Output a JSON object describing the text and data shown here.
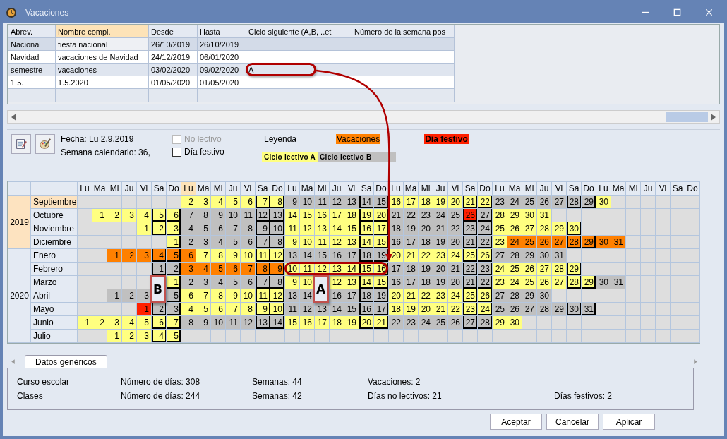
{
  "window": {
    "title": "Vacaciones"
  },
  "holidays": {
    "columns": [
      {
        "label": "Abrev.",
        "selected": false
      },
      {
        "label": "Nombre compl.",
        "selected": true
      },
      {
        "label": "Desde",
        "selected": false
      },
      {
        "label": "Hasta",
        "selected": false
      },
      {
        "label": "Ciclo siguiente (A,B, ..et",
        "selected": false
      },
      {
        "label": "Número de la semana pos",
        "selected": false
      }
    ],
    "rows": [
      {
        "selected": true,
        "cells": [
          "Nacional",
          "fiesta nacional",
          "26/10/2019",
          "26/10/2019"
        ]
      },
      {
        "selected": false,
        "cells": [
          "Navidad",
          "vacaciones de Navidad",
          "24/12/2019",
          "06/01/2020"
        ]
      },
      {
        "selected": false,
        "cells": [
          "semestre",
          "vacaciones",
          "03/02/2020",
          "09/02/2020",
          "A"
        ]
      },
      {
        "selected": false,
        "cells": [
          "1.5.",
          "1.5.2020",
          "01/05/2020",
          "01/05/2020"
        ]
      }
    ]
  },
  "date_info": {
    "fecha": "Fecha: Lu 2.9.2019",
    "semana": "Semana calendario: 36,"
  },
  "checkboxes": [
    {
      "label": "No lectivo",
      "checked": false,
      "disabled": true
    },
    {
      "label": "Día festivo",
      "checked": false,
      "disabled": false
    }
  ],
  "legend": {
    "title": "Leyenda",
    "items": [
      {
        "label": "Vacaciones",
        "kind": "vacation"
      },
      {
        "label": "Día festivo",
        "kind": "holiday"
      },
      {
        "label": "Ciclo lectivo A",
        "kind": "a"
      },
      {
        "label": "Ciclo lectivo B",
        "kind": "b"
      }
    ]
  },
  "calendar": {
    "day_headers": [
      {
        "label": "Lu",
        "selected": false
      },
      {
        "label": "Ma",
        "selected": false
      },
      {
        "label": "Mi",
        "selected": false
      },
      {
        "label": "Ju",
        "selected": false
      },
      {
        "label": "Vi",
        "selected": false
      },
      {
        "label": "Sa",
        "selected": false
      },
      {
        "label": "Do",
        "selected": false
      },
      {
        "label": "Lu",
        "selected": true
      },
      {
        "label": "Ma",
        "selected": false
      },
      {
        "label": "Mi",
        "selected": false
      },
      {
        "label": "Ju",
        "selected": false
      },
      {
        "label": "Vi",
        "selected": false
      },
      {
        "label": "Sa",
        "selected": false
      },
      {
        "label": "Do",
        "selected": false
      },
      {
        "label": "Lu",
        "selected": false
      },
      {
        "label": "Ma",
        "selected": false
      },
      {
        "label": "Mi",
        "selected": false
      },
      {
        "label": "Ju",
        "selected": false
      },
      {
        "label": "Vi",
        "selected": false
      },
      {
        "label": "Sa",
        "selected": false
      },
      {
        "label": "Do",
        "selected": false
      },
      {
        "label": "Lu",
        "selected": false
      },
      {
        "label": "Ma",
        "selected": false
      },
      {
        "label": "Mi",
        "selected": false
      },
      {
        "label": "Ju",
        "selected": false
      },
      {
        "label": "Vi",
        "selected": false
      },
      {
        "label": "Sa",
        "selected": false
      },
      {
        "label": "Do",
        "selected": false
      },
      {
        "label": "Lu",
        "selected": false
      },
      {
        "label": "Ma",
        "selected": false
      },
      {
        "label": "Mi",
        "selected": false
      },
      {
        "label": "Ju",
        "selected": false
      },
      {
        "label": "Vi",
        "selected": false
      },
      {
        "label": "Sa",
        "selected": false
      },
      {
        "label": "Do",
        "selected": false
      },
      {
        "label": "Lu",
        "selected": false
      },
      {
        "label": "Ma",
        "selected": false
      },
      {
        "label": "Mi",
        "selected": false
      },
      {
        "label": "Ju",
        "selected": false
      },
      {
        "label": "Vi",
        "selected": false
      },
      {
        "label": "Sa",
        "selected": false
      },
      {
        "label": "Do",
        "selected": false
      }
    ],
    "years": [
      {
        "label": "2019",
        "selected": true,
        "months": [
          {
            "name": "Septiembre",
            "selected": true,
            "cells": [
              {
                "kind": "blank"
              },
              {
                "kind": "blank"
              },
              {
                "kind": "blank"
              },
              {
                "kind": "blank"
              },
              {
                "kind": "blank"
              },
              {
                "kind": "blank"
              },
              {
                "kind": "blank"
              },
              {
                "day": "2",
                "kind": "a"
              },
              {
                "day": "3",
                "kind": "a"
              },
              {
                "day": "4",
                "kind": "a"
              },
              {
                "day": "5",
                "kind": "a"
              },
              {
                "day": "6",
                "kind": "a"
              },
              {
                "day": "7",
                "kind": "a"
              },
              {
                "day": "8",
                "kind": "a"
              },
              {
                "day": "9",
                "kind": "b"
              },
              {
                "day": "10",
                "kind": "b"
              },
              {
                "day": "11",
                "kind": "b"
              },
              {
                "day": "12",
                "kind": "b"
              },
              {
                "day": "13",
                "kind": "b"
              },
              {
                "day": "14",
                "kind": "b"
              },
              {
                "day": "15",
                "kind": "b"
              },
              {
                "day": "16",
                "kind": "a"
              },
              {
                "day": "17",
                "kind": "a"
              },
              {
                "day": "18",
                "kind": "a"
              },
              {
                "day": "19",
                "kind": "a"
              },
              {
                "day": "20",
                "kind": "a"
              },
              {
                "day": "21",
                "kind": "a"
              },
              {
                "day": "22",
                "kind": "a"
              },
              {
                "day": "23",
                "kind": "b"
              },
              {
                "day": "24",
                "kind": "b"
              },
              {
                "day": "25",
                "kind": "b"
              },
              {
                "day": "26",
                "kind": "b"
              },
              {
                "day": "27",
                "kind": "b"
              },
              {
                "day": "28",
                "kind": "b"
              },
              {
                "day": "29",
                "kind": "b"
              },
              {
                "day": "30",
                "kind": "a"
              }
            ]
          },
          {
            "name": "Octubre",
            "selected": false,
            "cells": [
              {
                "kind": "blank"
              },
              {
                "day": "1",
                "kind": "a"
              },
              {
                "day": "2",
                "kind": "a"
              },
              {
                "day": "3",
                "kind": "a"
              },
              {
                "day": "4",
                "kind": "a"
              },
              {
                "day": "5",
                "kind": "a"
              },
              {
                "day": "6",
                "kind": "a"
              },
              {
                "day": "7",
                "kind": "b"
              },
              {
                "day": "8",
                "kind": "b"
              },
              {
                "day": "9",
                "kind": "b"
              },
              {
                "day": "10",
                "kind": "b"
              },
              {
                "day": "11",
                "kind": "b"
              },
              {
                "day": "12",
                "kind": "b"
              },
              {
                "day": "13",
                "kind": "b"
              },
              {
                "day": "14",
                "kind": "a"
              },
              {
                "day": "15",
                "kind": "a"
              },
              {
                "day": "16",
                "kind": "a"
              },
              {
                "day": "17",
                "kind": "a"
              },
              {
                "day": "18",
                "kind": "a"
              },
              {
                "day": "19",
                "kind": "a"
              },
              {
                "day": "20",
                "kind": "a"
              },
              {
                "day": "21",
                "kind": "b"
              },
              {
                "day": "22",
                "kind": "b"
              },
              {
                "day": "23",
                "kind": "b"
              },
              {
                "day": "24",
                "kind": "b"
              },
              {
                "day": "25",
                "kind": "b"
              },
              {
                "day": "26",
                "kind": "holiday"
              },
              {
                "day": "27",
                "kind": "b"
              },
              {
                "day": "28",
                "kind": "a"
              },
              {
                "day": "29",
                "kind": "a"
              },
              {
                "day": "30",
                "kind": "a"
              },
              {
                "day": "31",
                "kind": "a"
              }
            ]
          },
          {
            "name": "Noviembre",
            "selected": false,
            "cells": [
              {
                "kind": "blank"
              },
              {
                "kind": "blank"
              },
              {
                "kind": "blank"
              },
              {
                "kind": "blank"
              },
              {
                "day": "1",
                "kind": "a"
              },
              {
                "day": "2",
                "kind": "a"
              },
              {
                "day": "3",
                "kind": "a"
              },
              {
                "day": "4",
                "kind": "b"
              },
              {
                "day": "5",
                "kind": "b"
              },
              {
                "day": "6",
                "kind": "b"
              },
              {
                "day": "7",
                "kind": "b"
              },
              {
                "day": "8",
                "kind": "b"
              },
              {
                "day": "9",
                "kind": "b"
              },
              {
                "day": "10",
                "kind": "b"
              },
              {
                "day": "11",
                "kind": "a"
              },
              {
                "day": "12",
                "kind": "a"
              },
              {
                "day": "13",
                "kind": "a"
              },
              {
                "day": "14",
                "kind": "a"
              },
              {
                "day": "15",
                "kind": "a"
              },
              {
                "day": "16",
                "kind": "a"
              },
              {
                "day": "17",
                "kind": "a"
              },
              {
                "day": "18",
                "kind": "b"
              },
              {
                "day": "19",
                "kind": "b"
              },
              {
                "day": "20",
                "kind": "b"
              },
              {
                "day": "21",
                "kind": "b"
              },
              {
                "day": "22",
                "kind": "b"
              },
              {
                "day": "23",
                "kind": "b"
              },
              {
                "day": "24",
                "kind": "b"
              },
              {
                "day": "25",
                "kind": "a"
              },
              {
                "day": "26",
                "kind": "a"
              },
              {
                "day": "27",
                "kind": "a"
              },
              {
                "day": "28",
                "kind": "a"
              },
              {
                "day": "29",
                "kind": "a"
              },
              {
                "day": "30",
                "kind": "a"
              }
            ]
          },
          {
            "name": "Diciembre",
            "selected": false,
            "cells": [
              {
                "kind": "blank"
              },
              {
                "kind": "blank"
              },
              {
                "kind": "blank"
              },
              {
                "kind": "blank"
              },
              {
                "kind": "blank"
              },
              {
                "kind": "blank"
              },
              {
                "day": "1",
                "kind": "a"
              },
              {
                "day": "2",
                "kind": "b"
              },
              {
                "day": "3",
                "kind": "b"
              },
              {
                "day": "4",
                "kind": "b"
              },
              {
                "day": "5",
                "kind": "b"
              },
              {
                "day": "6",
                "kind": "b"
              },
              {
                "day": "7",
                "kind": "b"
              },
              {
                "day": "8",
                "kind": "b"
              },
              {
                "day": "9",
                "kind": "a"
              },
              {
                "day": "10",
                "kind": "a"
              },
              {
                "day": "11",
                "kind": "a"
              },
              {
                "day": "12",
                "kind": "a"
              },
              {
                "day": "13",
                "kind": "a"
              },
              {
                "day": "14",
                "kind": "a"
              },
              {
                "day": "15",
                "kind": "a"
              },
              {
                "day": "16",
                "kind": "b"
              },
              {
                "day": "17",
                "kind": "b"
              },
              {
                "day": "18",
                "kind": "b"
              },
              {
                "day": "19",
                "kind": "b"
              },
              {
                "day": "20",
                "kind": "b"
              },
              {
                "day": "21",
                "kind": "b"
              },
              {
                "day": "22",
                "kind": "b"
              },
              {
                "day": "23",
                "kind": "a"
              },
              {
                "day": "24",
                "kind": "vacation"
              },
              {
                "day": "25",
                "kind": "vacation"
              },
              {
                "day": "26",
                "kind": "vacation"
              },
              {
                "day": "27",
                "kind": "vacation"
              },
              {
                "day": "28",
                "kind": "vacation"
              },
              {
                "day": "29",
                "kind": "vacation"
              },
              {
                "day": "30",
                "kind": "vacation"
              },
              {
                "day": "31",
                "kind": "vacation"
              }
            ]
          }
        ]
      },
      {
        "label": "2020",
        "selected": false,
        "months": [
          {
            "name": "Enero",
            "selected": false,
            "cells": [
              {
                "kind": "blank"
              },
              {
                "kind": "blank"
              },
              {
                "day": "1",
                "kind": "vacation"
              },
              {
                "day": "2",
                "kind": "vacation"
              },
              {
                "day": "3",
                "kind": "vacation"
              },
              {
                "day": "4",
                "kind": "vacation"
              },
              {
                "day": "5",
                "kind": "vacation"
              },
              {
                "day": "6",
                "kind": "vacation"
              },
              {
                "day": "7",
                "kind": "a"
              },
              {
                "day": "8",
                "kind": "a"
              },
              {
                "day": "9",
                "kind": "a"
              },
              {
                "day": "10",
                "kind": "a"
              },
              {
                "day": "11",
                "kind": "a"
              },
              {
                "day": "12",
                "kind": "a"
              },
              {
                "day": "13",
                "kind": "b"
              },
              {
                "day": "14",
                "kind": "b"
              },
              {
                "day": "15",
                "kind": "b"
              },
              {
                "day": "16",
                "kind": "b"
              },
              {
                "day": "17",
                "kind": "b"
              },
              {
                "day": "18",
                "kind": "b"
              },
              {
                "day": "19",
                "kind": "b"
              },
              {
                "day": "20",
                "kind": "a"
              },
              {
                "day": "21",
                "kind": "a"
              },
              {
                "day": "22",
                "kind": "a"
              },
              {
                "day": "23",
                "kind": "a"
              },
              {
                "day": "24",
                "kind": "a"
              },
              {
                "day": "25",
                "kind": "a"
              },
              {
                "day": "26",
                "kind": "a"
              },
              {
                "day": "27",
                "kind": "b"
              },
              {
                "day": "28",
                "kind": "b"
              },
              {
                "day": "29",
                "kind": "b"
              },
              {
                "day": "30",
                "kind": "b"
              },
              {
                "day": "31",
                "kind": "b"
              }
            ]
          },
          {
            "name": "Febrero",
            "selected": false,
            "cells": [
              {
                "kind": "blank"
              },
              {
                "kind": "blank"
              },
              {
                "kind": "blank"
              },
              {
                "kind": "blank"
              },
              {
                "kind": "blank"
              },
              {
                "day": "1",
                "kind": "b"
              },
              {
                "day": "2",
                "kind": "b"
              },
              {
                "day": "3",
                "kind": "vacation"
              },
              {
                "day": "4",
                "kind": "vacation"
              },
              {
                "day": "5",
                "kind": "vacation"
              },
              {
                "day": "6",
                "kind": "vacation"
              },
              {
                "day": "7",
                "kind": "vacation"
              },
              {
                "day": "8",
                "kind": "vacation"
              },
              {
                "day": "9",
                "kind": "vacation"
              },
              {
                "day": "10",
                "kind": "a"
              },
              {
                "day": "11",
                "kind": "a"
              },
              {
                "day": "12",
                "kind": "a"
              },
              {
                "day": "13",
                "kind": "a"
              },
              {
                "day": "14",
                "kind": "a"
              },
              {
                "day": "15",
                "kind": "a"
              },
              {
                "day": "16",
                "kind": "a"
              },
              {
                "day": "17",
                "kind": "b"
              },
              {
                "day": "18",
                "kind": "b"
              },
              {
                "day": "19",
                "kind": "b"
              },
              {
                "day": "20",
                "kind": "b"
              },
              {
                "day": "21",
                "kind": "b"
              },
              {
                "day": "22",
                "kind": "b"
              },
              {
                "day": "23",
                "kind": "b"
              },
              {
                "day": "24",
                "kind": "a"
              },
              {
                "day": "25",
                "kind": "a"
              },
              {
                "day": "26",
                "kind": "a"
              },
              {
                "day": "27",
                "kind": "a"
              },
              {
                "day": "28",
                "kind": "a"
              },
              {
                "day": "29",
                "kind": "a"
              }
            ]
          },
          {
            "name": "Marzo",
            "selected": false,
            "cells": [
              {
                "kind": "blank"
              },
              {
                "kind": "blank"
              },
              {
                "kind": "blank"
              },
              {
                "kind": "blank"
              },
              {
                "kind": "blank"
              },
              {
                "kind": "hidden"
              },
              {
                "day": "1",
                "kind": "a"
              },
              {
                "day": "2",
                "kind": "b"
              },
              {
                "day": "3",
                "kind": "b"
              },
              {
                "day": "4",
                "kind": "b"
              },
              {
                "day": "5",
                "kind": "b"
              },
              {
                "day": "6",
                "kind": "b"
              },
              {
                "day": "7",
                "kind": "b"
              },
              {
                "day": "8",
                "kind": "b"
              },
              {
                "day": "9",
                "kind": "a"
              },
              {
                "day": "10",
                "kind": "a"
              },
              {
                "kind": "hidden"
              },
              {
                "day": "12",
                "kind": "a"
              },
              {
                "day": "13",
                "kind": "a"
              },
              {
                "day": "14",
                "kind": "a"
              },
              {
                "day": "15",
                "kind": "a"
              },
              {
                "day": "16",
                "kind": "b"
              },
              {
                "day": "17",
                "kind": "b"
              },
              {
                "day": "18",
                "kind": "b"
              },
              {
                "day": "19",
                "kind": "b"
              },
              {
                "day": "20",
                "kind": "b"
              },
              {
                "day": "21",
                "kind": "b"
              },
              {
                "day": "22",
                "kind": "b"
              },
              {
                "day": "23",
                "kind": "a"
              },
              {
                "day": "24",
                "kind": "a"
              },
              {
                "day": "25",
                "kind": "a"
              },
              {
                "day": "26",
                "kind": "a"
              },
              {
                "day": "27",
                "kind": "a"
              },
              {
                "day": "28",
                "kind": "a"
              },
              {
                "day": "29",
                "kind": "a"
              },
              {
                "day": "30",
                "kind": "b"
              },
              {
                "day": "31",
                "kind": "b"
              }
            ]
          },
          {
            "name": "Abril",
            "selected": false,
            "cells": [
              {
                "kind": "blank"
              },
              {
                "kind": "blank"
              },
              {
                "day": "1",
                "kind": "b"
              },
              {
                "day": "2",
                "kind": "b"
              },
              {
                "day": "3",
                "kind": "b"
              },
              {
                "kind": "hidden"
              },
              {
                "day": "5",
                "kind": "b"
              },
              {
                "day": "6",
                "kind": "a"
              },
              {
                "day": "7",
                "kind": "a"
              },
              {
                "day": "8",
                "kind": "a"
              },
              {
                "day": "9",
                "kind": "a"
              },
              {
                "day": "10",
                "kind": "a"
              },
              {
                "day": "11",
                "kind": "a"
              },
              {
                "day": "12",
                "kind": "a"
              },
              {
                "day": "13",
                "kind": "b"
              },
              {
                "day": "14",
                "kind": "b"
              },
              {
                "kind": "hidden"
              },
              {
                "day": "16",
                "kind": "b"
              },
              {
                "day": "17",
                "kind": "b"
              },
              {
                "day": "18",
                "kind": "b"
              },
              {
                "day": "19",
                "kind": "b"
              },
              {
                "day": "20",
                "kind": "a"
              },
              {
                "day": "21",
                "kind": "a"
              },
              {
                "day": "22",
                "kind": "a"
              },
              {
                "day": "23",
                "kind": "a"
              },
              {
                "day": "24",
                "kind": "a"
              },
              {
                "day": "25",
                "kind": "a"
              },
              {
                "day": "26",
                "kind": "a"
              },
              {
                "day": "27",
                "kind": "b"
              },
              {
                "day": "28",
                "kind": "b"
              },
              {
                "day": "29",
                "kind": "b"
              },
              {
                "day": "30",
                "kind": "b"
              }
            ]
          },
          {
            "name": "Mayo",
            "selected": false,
            "cells": [
              {
                "kind": "blank"
              },
              {
                "kind": "blank"
              },
              {
                "kind": "blank"
              },
              {
                "kind": "blank"
              },
              {
                "day": "1",
                "kind": "holiday"
              },
              {
                "day": "2",
                "kind": "b"
              },
              {
                "day": "3",
                "kind": "b"
              },
              {
                "day": "4",
                "kind": "a"
              },
              {
                "day": "5",
                "kind": "a"
              },
              {
                "day": "6",
                "kind": "a"
              },
              {
                "day": "7",
                "kind": "a"
              },
              {
                "day": "8",
                "kind": "a"
              },
              {
                "day": "9",
                "kind": "a"
              },
              {
                "day": "10",
                "kind": "a"
              },
              {
                "day": "11",
                "kind": "b"
              },
              {
                "day": "12",
                "kind": "b"
              },
              {
                "day": "13",
                "kind": "b"
              },
              {
                "day": "14",
                "kind": "b"
              },
              {
                "day": "15",
                "kind": "b"
              },
              {
                "day": "16",
                "kind": "b"
              },
              {
                "day": "17",
                "kind": "b"
              },
              {
                "day": "18",
                "kind": "a"
              },
              {
                "day": "19",
                "kind": "a"
              },
              {
                "day": "20",
                "kind": "a"
              },
              {
                "day": "21",
                "kind": "a"
              },
              {
                "day": "22",
                "kind": "a"
              },
              {
                "day": "23",
                "kind": "a"
              },
              {
                "day": "24",
                "kind": "a"
              },
              {
                "day": "25",
                "kind": "b"
              },
              {
                "day": "26",
                "kind": "b"
              },
              {
                "day": "27",
                "kind": "b"
              },
              {
                "day": "28",
                "kind": "b"
              },
              {
                "day": "29",
                "kind": "b"
              },
              {
                "day": "30",
                "kind": "b"
              },
              {
                "day": "31",
                "kind": "b"
              }
            ]
          },
          {
            "name": "Junio",
            "selected": false,
            "cells": [
              {
                "day": "1",
                "kind": "a"
              },
              {
                "day": "2",
                "kind": "a"
              },
              {
                "day": "3",
                "kind": "a"
              },
              {
                "day": "4",
                "kind": "a"
              },
              {
                "day": "5",
                "kind": "a"
              },
              {
                "day": "6",
                "kind": "a"
              },
              {
                "day": "7",
                "kind": "a"
              },
              {
                "day": "8",
                "kind": "b"
              },
              {
                "day": "9",
                "kind": "b"
              },
              {
                "day": "10",
                "kind": "b"
              },
              {
                "day": "11",
                "kind": "b"
              },
              {
                "day": "12",
                "kind": "b"
              },
              {
                "day": "13",
                "kind": "b"
              },
              {
                "day": "14",
                "kind": "b"
              },
              {
                "day": "15",
                "kind": "a"
              },
              {
                "day": "16",
                "kind": "a"
              },
              {
                "day": "17",
                "kind": "a"
              },
              {
                "day": "18",
                "kind": "a"
              },
              {
                "day": "19",
                "kind": "a"
              },
              {
                "day": "20",
                "kind": "a"
              },
              {
                "day": "21",
                "kind": "a"
              },
              {
                "day": "22",
                "kind": "b"
              },
              {
                "day": "23",
                "kind": "b"
              },
              {
                "day": "24",
                "kind": "b"
              },
              {
                "day": "25",
                "kind": "b"
              },
              {
                "day": "26",
                "kind": "b"
              },
              {
                "day": "27",
                "kind": "b"
              },
              {
                "day": "28",
                "kind": "b"
              },
              {
                "day": "29",
                "kind": "a"
              },
              {
                "day": "30",
                "kind": "a"
              }
            ]
          },
          {
            "name": "Julio",
            "selected": false,
            "cells": [
              {
                "kind": "blank"
              },
              {
                "kind": "blank"
              },
              {
                "day": "1",
                "kind": "a"
              },
              {
                "day": "2",
                "kind": "a"
              },
              {
                "day": "3",
                "kind": "a"
              },
              {
                "day": "4",
                "kind": "a"
              },
              {
                "day": "5",
                "kind": "a"
              }
            ]
          }
        ]
      }
    ]
  },
  "annotations": [
    {
      "label": "B"
    },
    {
      "label": "A"
    }
  ],
  "tabs": [
    {
      "label": "Datos genéricos",
      "selected": true
    }
  ],
  "stats": [
    {
      "label": "Curso escolar",
      "values": [
        "Número de días: 308",
        "Semanas: 44",
        "Vacaciones: 2"
      ]
    },
    {
      "label": "Clases",
      "values": [
        "Número de días: 244",
        "Semanas: 42",
        "Días no lectivos: 21",
        "Días festivos: 2"
      ]
    }
  ],
  "buttons": [
    "Aceptar",
    "Cancelar",
    "Aplicar"
  ]
}
